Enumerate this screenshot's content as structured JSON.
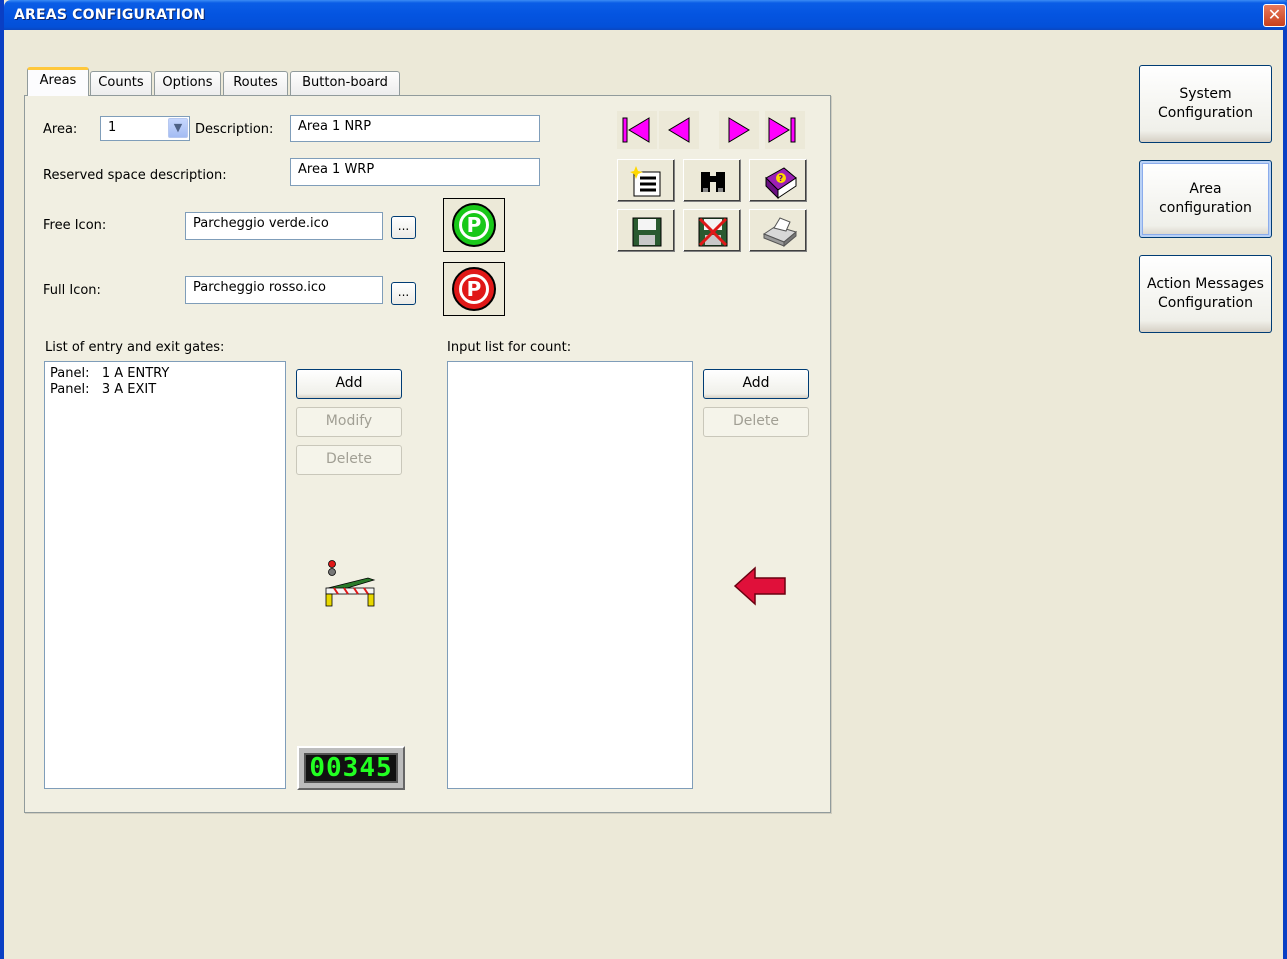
{
  "window": {
    "title": "AREAS CONFIGURATION",
    "close_glyph": "✕"
  },
  "tabs": [
    {
      "label": "Areas",
      "active": true
    },
    {
      "label": "Counts"
    },
    {
      "label": "Options"
    },
    {
      "label": "Routes"
    },
    {
      "label": "Button-board"
    }
  ],
  "form": {
    "area_label": "Area:",
    "area_value": "1",
    "description_label": "Description:",
    "description_value": "Area 1 NRP",
    "reserved_label": "Reserved space description:",
    "reserved_value": "Area 1 WRP",
    "free_icon_label": "Free Icon:",
    "free_icon_value": "Parcheggio verde.ico",
    "full_icon_label": "Full Icon:",
    "full_icon_value": "Parcheggio rosso.ico",
    "browse_label": "...",
    "free_icon_glyph": "P",
    "full_icon_glyph": "P"
  },
  "toolbar": {
    "first_icon": "first-record-icon",
    "prev_icon": "previous-record-icon",
    "next_icon": "next-record-icon",
    "last_icon": "last-record-icon",
    "new_icon": "new-record-icon",
    "find_icon": "binoculars-icon",
    "help_icon": "help-book-icon",
    "save_icon": "save-icon",
    "cancel_icon": "cancel-save-icon",
    "print_icon": "printer-icon"
  },
  "gates": {
    "title": "List of entry and exit gates:",
    "items": [
      "Panel:   1 A ENTRY",
      "Panel:   3 A EXIT"
    ],
    "add_label": "Add",
    "modify_label": "Modify",
    "delete_label": "Delete"
  },
  "counts": {
    "title": "Input list for count:",
    "items": [],
    "add_label": "Add",
    "delete_label": "Delete"
  },
  "counter_display": "00345",
  "side_buttons": {
    "system": [
      "System",
      "Configuration"
    ],
    "area": [
      "Area",
      "configuration"
    ],
    "action": [
      "Action Messages",
      "Configuration"
    ]
  },
  "colors": {
    "titlebar": "#0454e0",
    "free_icon": "#18c818",
    "full_icon": "#e01818",
    "nav_arrows": "#ff00ff",
    "arrow_red": "#e0103a"
  }
}
